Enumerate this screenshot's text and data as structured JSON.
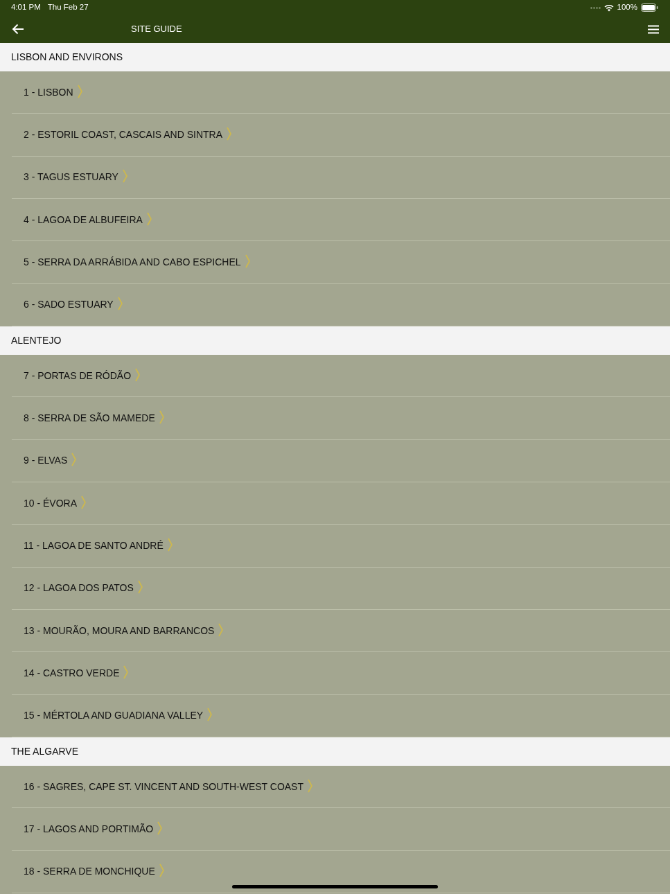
{
  "status_bar": {
    "time": "4:01 PM",
    "date": "Thu Feb 27",
    "battery": "100%"
  },
  "nav_bar": {
    "title": "SITE GUIDE"
  },
  "sections": [
    {
      "title": "LISBON AND ENVIRONS",
      "items": [
        {
          "label": "1 - LISBON"
        },
        {
          "label": "2 - ESTORIL COAST, CASCAIS AND SINTRA"
        },
        {
          "label": "3 - TAGUS ESTUARY"
        },
        {
          "label": "4 - LAGOA DE ALBUFEIRA"
        },
        {
          "label": "5 - SERRA DA ARRÁBIDA AND CABO ESPICHEL"
        },
        {
          "label": "6 - SADO ESTUARY"
        }
      ]
    },
    {
      "title": "ALENTEJO",
      "items": [
        {
          "label": "7 - PORTAS DE RÓDÃO"
        },
        {
          "label": "8 - SERRA DE SÃO MAMEDE"
        },
        {
          "label": "9 - ELVAS"
        },
        {
          "label": "10 - ÉVORA"
        },
        {
          "label": "11 - LAGOA DE SANTO ANDRÉ"
        },
        {
          "label": "12 - LAGOA DOS PATOS"
        },
        {
          "label": "13 - MOURÃO, MOURA AND BARRANCOS"
        },
        {
          "label": "14 - CASTRO VERDE"
        },
        {
          "label": "15 - MÉRTOLA AND GUADIANA VALLEY"
        }
      ]
    },
    {
      "title": "THE ALGARVE",
      "items": [
        {
          "label": "16 - SAGRES, CAPE ST. VINCENT AND SOUTH-WEST COAST"
        },
        {
          "label": "17 - LAGOS AND PORTIMÃO"
        },
        {
          "label": "18 - SERRA DE MONCHIQUE"
        }
      ]
    }
  ]
}
